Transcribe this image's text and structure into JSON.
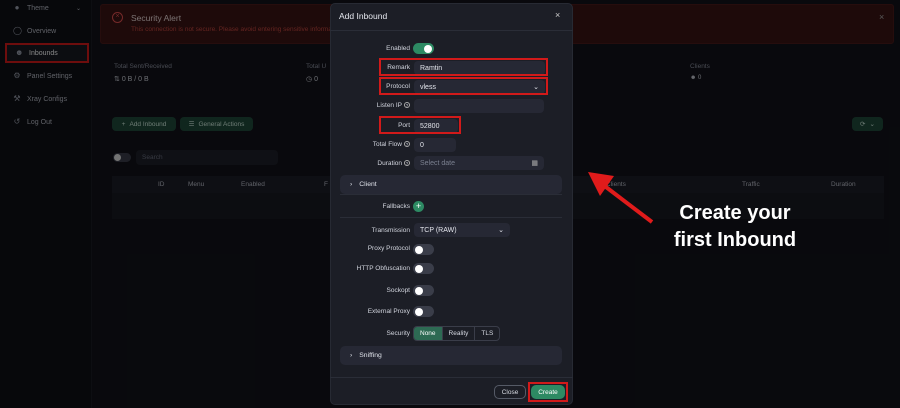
{
  "sidebar": {
    "items": [
      {
        "label": "Theme",
        "icon": "bulb-icon"
      },
      {
        "label": "Overview",
        "icon": "dashboard-icon"
      },
      {
        "label": "Inbounds",
        "icon": "user-icon"
      },
      {
        "label": "Panel Settings",
        "icon": "gear-icon"
      },
      {
        "label": "Xray Configs",
        "icon": "wrench-icon"
      },
      {
        "label": "Log Out",
        "icon": "logout-icon"
      }
    ]
  },
  "alert": {
    "title": "Security Alert",
    "text": "This connection is not secure. Please avoid entering sensitive information"
  },
  "stats": {
    "sent_received_label": "Total Sent/Received",
    "sent_received_value": "0 B / 0 B",
    "total_usage_label": "Total U",
    "total_usage_value": "0",
    "clients_label": "Clients",
    "clients_value": "0"
  },
  "toolbar": {
    "add_inbound": "Add Inbound",
    "general_actions": "General Actions"
  },
  "search": {
    "placeholder": "Search"
  },
  "table": {
    "headers": [
      "ID",
      "Menu",
      "Enabled",
      "F",
      "Clients",
      "Traffic",
      "Duration"
    ]
  },
  "modal": {
    "title": "Add Inbound",
    "enabled_label": "Enabled",
    "remark_label": "Remark",
    "remark_value": "Ramtin",
    "protocol_label": "Protocol",
    "protocol_value": "vless",
    "listen_ip_label": "Listen IP",
    "port_label": "Port",
    "port_value": "52800",
    "total_flow_label": "Total Flow",
    "total_flow_value": "0",
    "duration_label": "Duration",
    "duration_placeholder": "Select date",
    "client_label": "Client",
    "fallbacks_label": "Fallbacks",
    "transmission_label": "Transmission",
    "transmission_value": "TCP (RAW)",
    "proxy_protocol_label": "Proxy Protocol",
    "http_obfuscation_label": "HTTP Obfuscation",
    "sockopt_label": "Sockopt",
    "external_proxy_label": "External Proxy",
    "security_label": "Security",
    "security_options": [
      "None",
      "Reality",
      "TLS"
    ],
    "security_selected": "None",
    "sniffing_label": "Sniffing",
    "close_button": "Close",
    "create_button": "Create"
  },
  "annotation": {
    "line1": "Create your",
    "line2": "first Inbound"
  },
  "colors": {
    "accent": "#2d8a63",
    "highlight": "#d11a1a"
  }
}
